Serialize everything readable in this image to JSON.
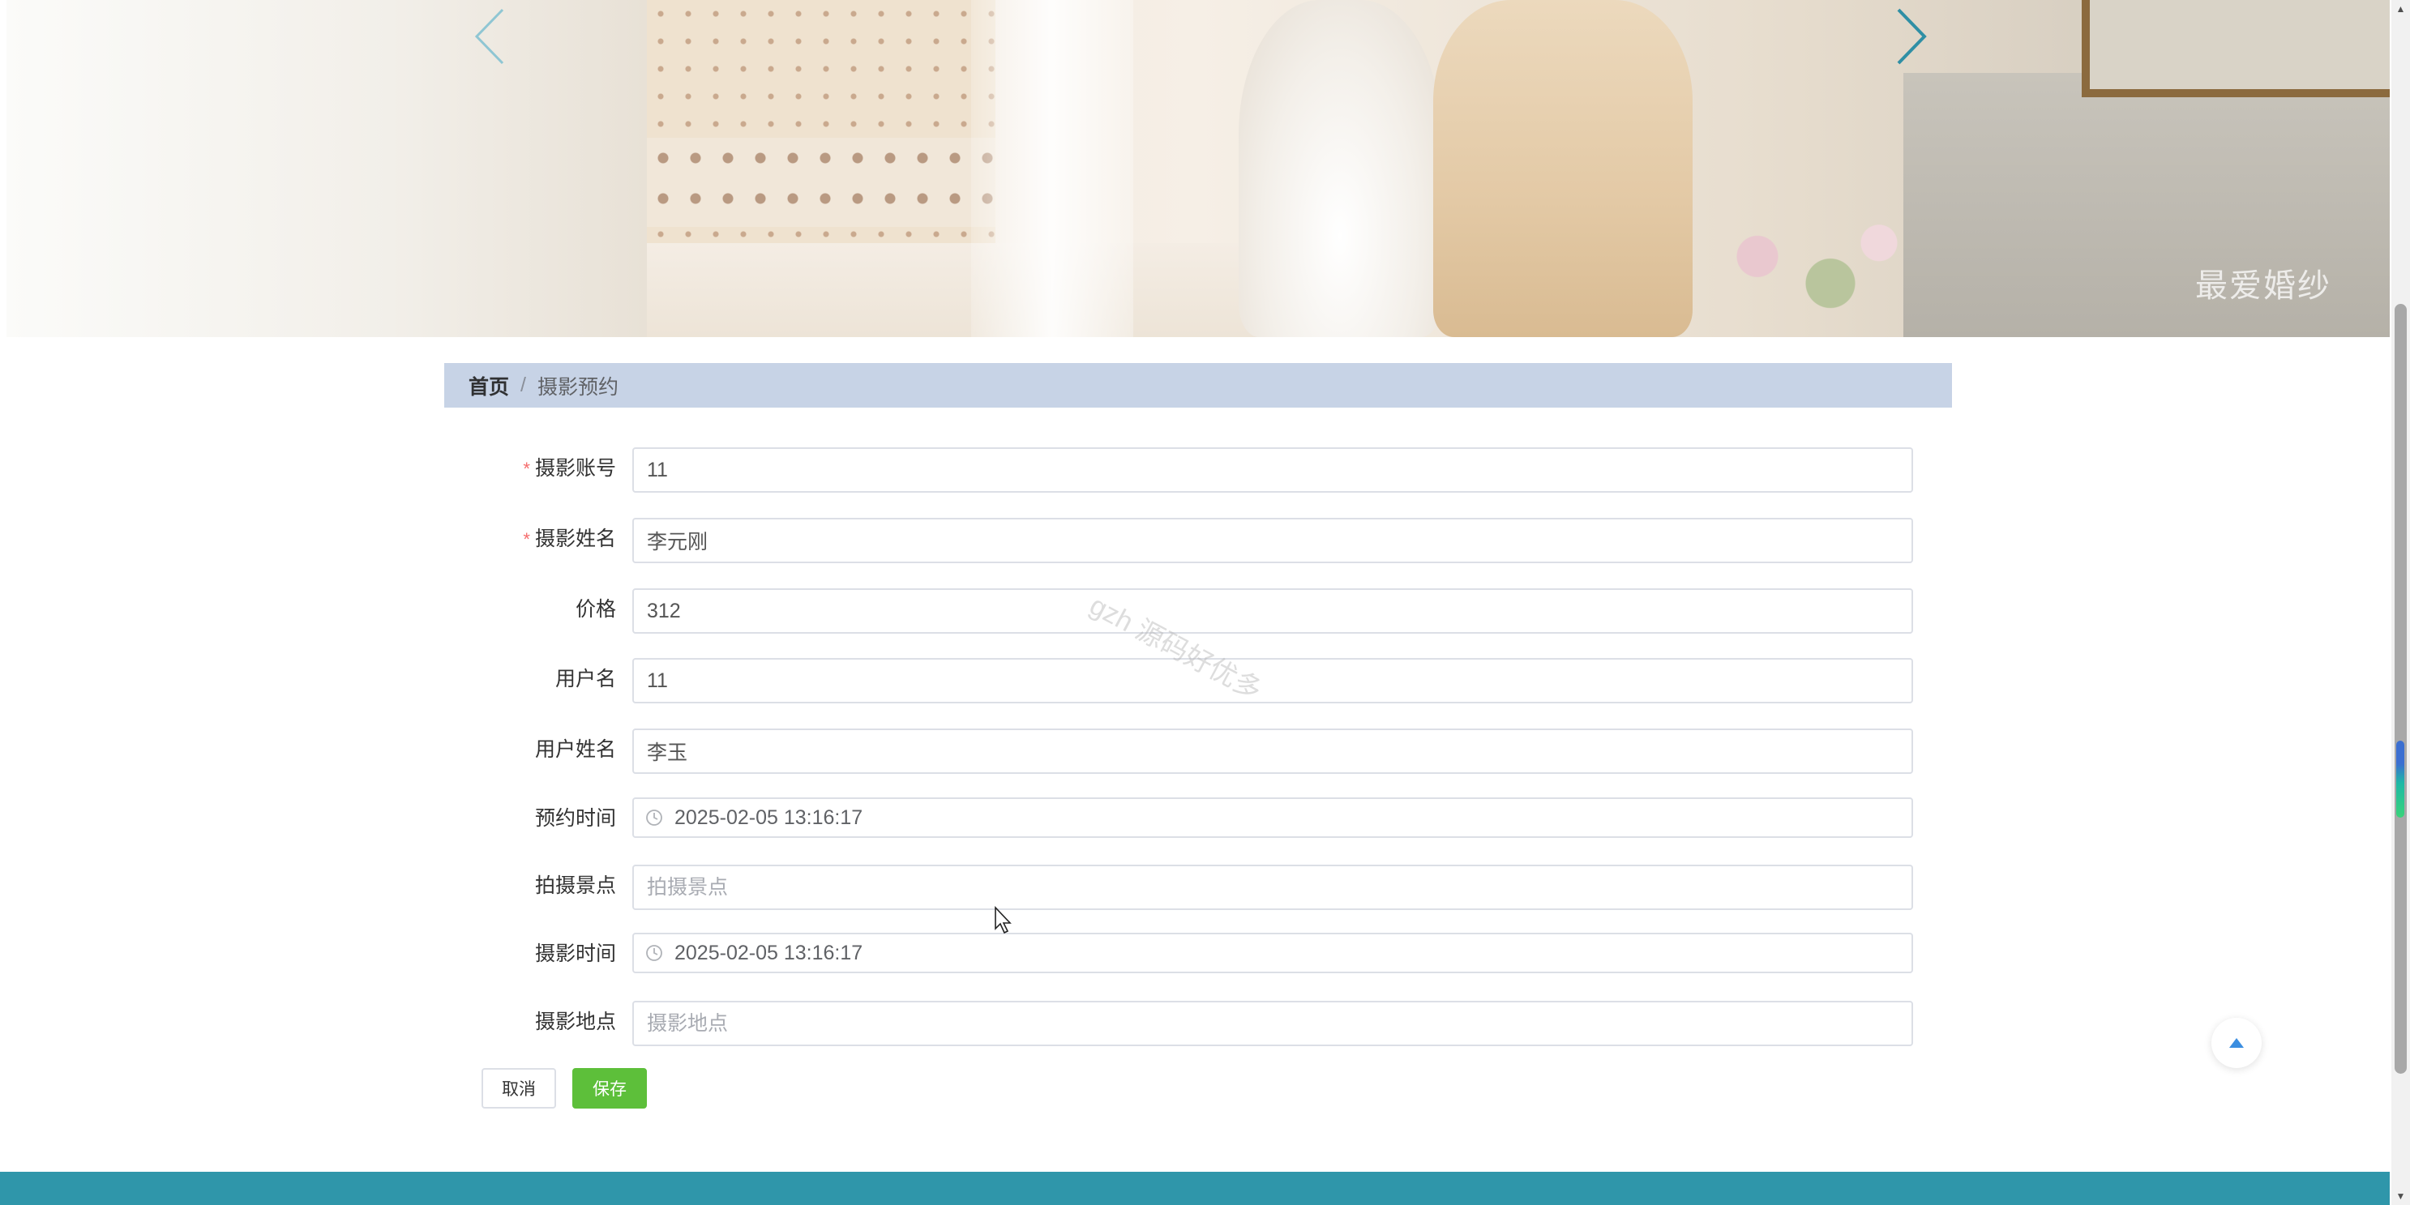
{
  "breadcrumb": {
    "home": "首页",
    "separator": "/",
    "current": "摄影预约"
  },
  "form": {
    "fields": [
      {
        "label": "摄影账号",
        "required": true,
        "value": "11",
        "placeholder": ""
      },
      {
        "label": "摄影姓名",
        "required": true,
        "value": "李元刚",
        "placeholder": ""
      },
      {
        "label": "价格",
        "required": false,
        "value": "312",
        "placeholder": ""
      },
      {
        "label": "用户名",
        "required": false,
        "value": "11",
        "placeholder": ""
      },
      {
        "label": "用户姓名",
        "required": false,
        "value": "李玉",
        "placeholder": ""
      },
      {
        "label": "预约时间",
        "required": false,
        "value": "2025-02-05 13:16:17",
        "placeholder": ""
      },
      {
        "label": "拍摄景点",
        "required": false,
        "value": "",
        "placeholder": "拍摄景点"
      },
      {
        "label": "摄影时间",
        "required": false,
        "value": "2025-02-05 13:16:17",
        "placeholder": ""
      },
      {
        "label": "摄影地点",
        "required": false,
        "value": "",
        "placeholder": "摄影地点"
      }
    ],
    "required_mark": "*"
  },
  "buttons": {
    "cancel": "取消",
    "save": "保存"
  },
  "watermark": "gzh 源码好优多",
  "icons": {
    "carousel_prev": "chevron-left-icon",
    "carousel_next": "chevron-right-icon",
    "date": "clock-icon",
    "back_to_top": "caret-up-icon"
  },
  "colors": {
    "breadcrumb_bg": "#c7d3e6",
    "save_button": "#5dbf3a",
    "required_mark": "#f56c6c",
    "footer_bar": "#2f96aa",
    "carousel_arrow": "#3aa0b5"
  }
}
